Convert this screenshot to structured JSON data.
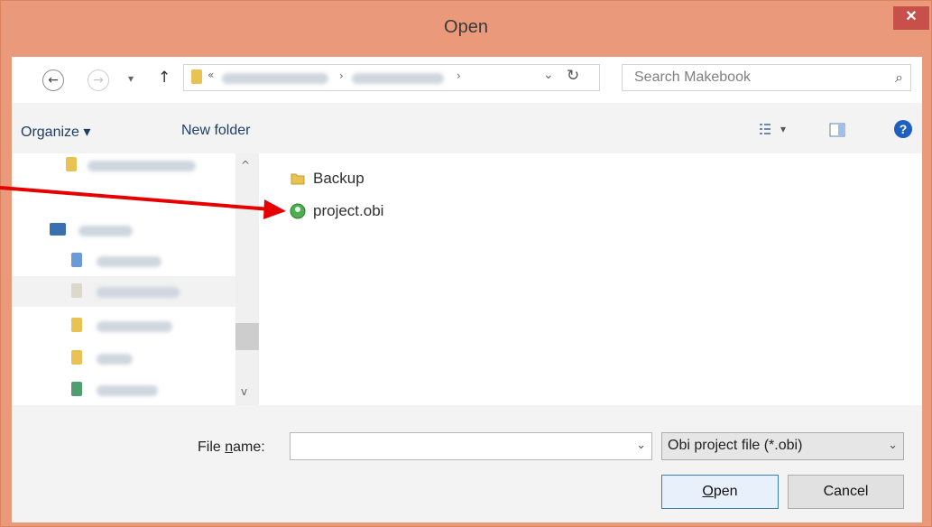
{
  "title": "Open",
  "close_symbol": "✕",
  "nav": {
    "back_symbol": "←",
    "forward_symbol": "→",
    "dropdown_symbol": "▾",
    "up_symbol": "↑",
    "refresh_symbol": "↻",
    "address_chevron": "«",
    "address_sep": "›",
    "address_dropdown": "⌄",
    "search_placeholder": "Search Makebook",
    "search_icon": "⌕"
  },
  "toolbar": {
    "organize": "Organize ▾",
    "new_folder": "New folder",
    "view_icon": "view-options-icon",
    "preview_icon": "preview-pane-icon",
    "help_icon": "?"
  },
  "files": [
    {
      "name": "Backup",
      "kind": "folder"
    },
    {
      "name": "project.obi",
      "kind": "obi"
    }
  ],
  "bottom": {
    "file_name_label_prefix": "File ",
    "file_name_label_u": "n",
    "file_name_label_suffix": "ame:",
    "file_name_value": "",
    "filter_value": "Obi project file (*.obi)",
    "open_u": "O",
    "open_rest": "pen",
    "cancel": "Cancel",
    "dropdown_symbol": "⌄"
  },
  "annotation": {
    "color": "#e60000"
  }
}
